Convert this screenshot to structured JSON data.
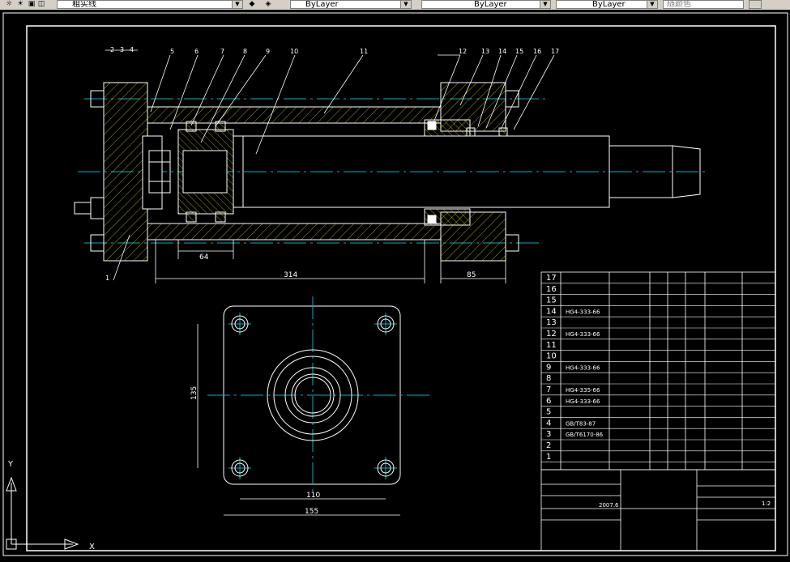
{
  "toolbar": {
    "layer_name": "粗实线",
    "color_value": "ByLayer",
    "linetype_value": "ByLayer",
    "lineweight_value": "ByLayer",
    "plotstyle_value": "随颜色"
  },
  "drawing": {
    "part_callouts": [
      "2",
      "3",
      "4",
      "5",
      "6",
      "7",
      "8",
      "9",
      "10",
      "11",
      "12",
      "13",
      "14",
      "15",
      "16",
      "17"
    ],
    "callout_1": "1",
    "dims": {
      "d64": "64",
      "d314": "314",
      "d85": "85",
      "d110": "110",
      "d155": "155",
      "d135": "135"
    }
  },
  "bom": {
    "rows": [
      {
        "no": "17",
        "code": ""
      },
      {
        "no": "16",
        "code": ""
      },
      {
        "no": "15",
        "code": ""
      },
      {
        "no": "14",
        "code": "HG4-333-66"
      },
      {
        "no": "13",
        "code": ""
      },
      {
        "no": "12",
        "code": "HG4-333-66"
      },
      {
        "no": "11",
        "code": ""
      },
      {
        "no": "10",
        "code": ""
      },
      {
        "no": "9",
        "code": "HG4-333-66"
      },
      {
        "no": "8",
        "code": ""
      },
      {
        "no": "7",
        "code": "HG4-335-66"
      },
      {
        "no": "6",
        "code": "HG4-333-66"
      },
      {
        "no": "5",
        "code": ""
      },
      {
        "no": "4",
        "code": "GB/T83-87"
      },
      {
        "no": "3",
        "code": "GB/T6170-86"
      },
      {
        "no": "2",
        "code": ""
      },
      {
        "no": "1",
        "code": ""
      }
    ],
    "title_block": {
      "ratio": "1:2",
      "date": "2007.6"
    }
  }
}
